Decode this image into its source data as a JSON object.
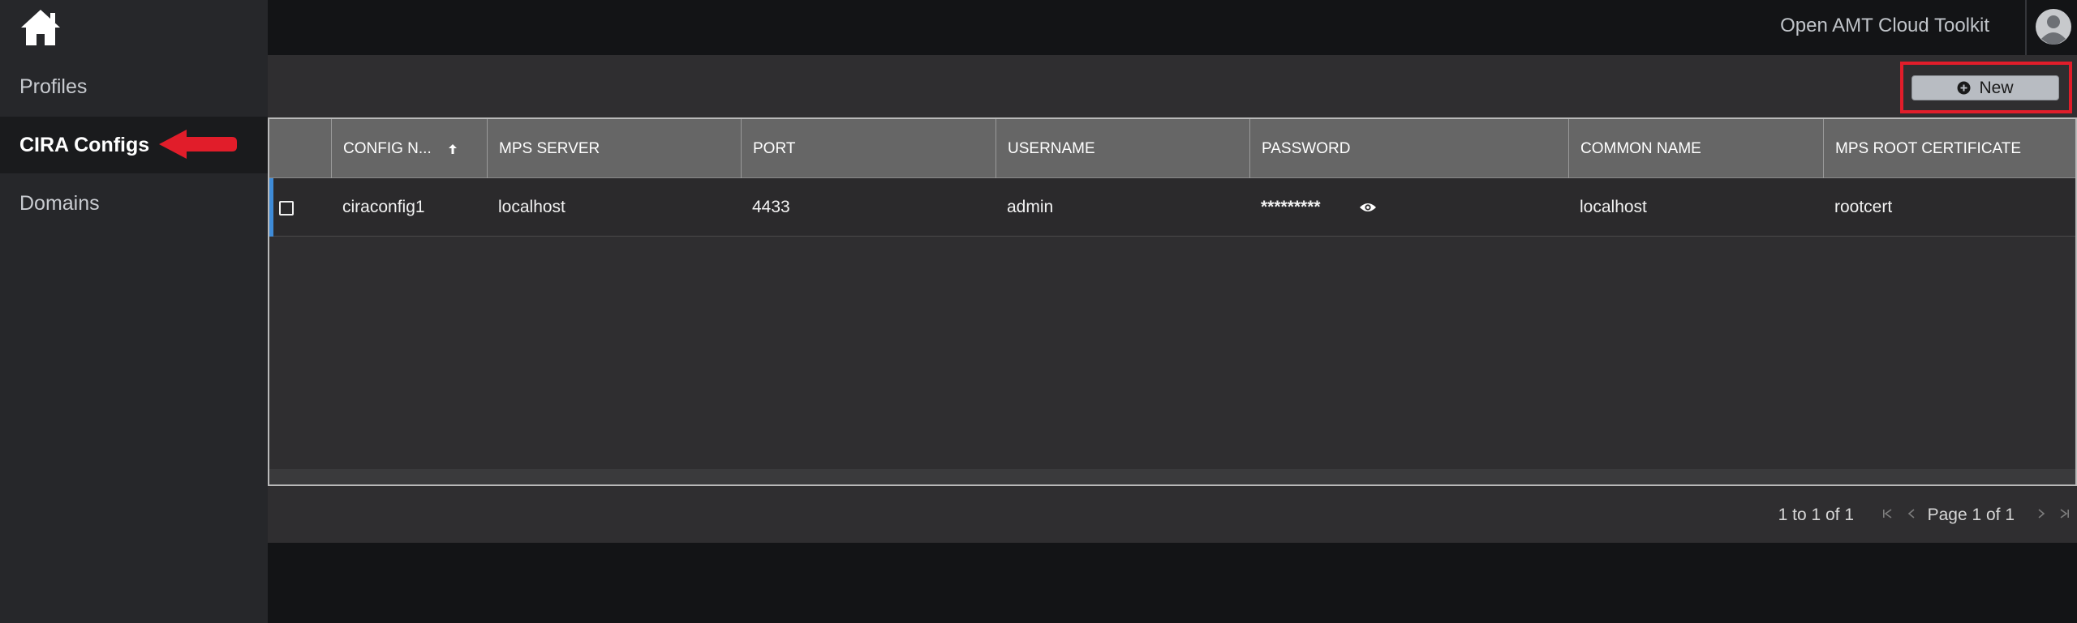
{
  "app": {
    "title": "Open AMT Cloud Toolkit"
  },
  "sidebar": {
    "items": [
      {
        "label": "Profiles"
      },
      {
        "label": "CIRA Configs",
        "active": true
      },
      {
        "label": "Domains"
      }
    ]
  },
  "toolbar": {
    "new_label": "New"
  },
  "grid": {
    "columns": [
      "CONFIG N...",
      "MPS SERVER",
      "PORT",
      "USERNAME",
      "PASSWORD",
      "COMMON NAME",
      "MPS ROOT CERTIFICATE"
    ],
    "sorted_column": "CONFIG N...",
    "sort_direction": "ascending",
    "rows": [
      {
        "config_name": "ciraconfig1",
        "mps_server": "localhost",
        "port": "4433",
        "username": "admin",
        "password": "*********",
        "common_name": "localhost",
        "root_cert": "rootcert"
      }
    ]
  },
  "pagination": {
    "row_count": "1 to 1 of 1",
    "page_info": "Page 1 of 1"
  },
  "colors": {
    "highlight": "#e11d2a",
    "arrow": "#e11d2a",
    "row_accent": "#3e8bd8"
  },
  "icons": [
    "home-icon",
    "user-avatar-icon",
    "plus-circle-icon",
    "sort-ascending-icon",
    "eye-icon",
    "first-page-icon",
    "previous-page-icon",
    "next-page-icon",
    "last-page-icon"
  ]
}
